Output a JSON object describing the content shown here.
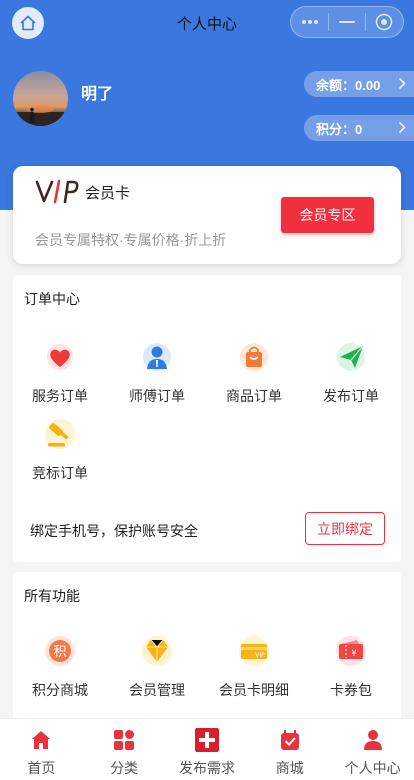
{
  "nav": {
    "title": "个人中心"
  },
  "user": {
    "name": "明了"
  },
  "account": {
    "balance_label": "余额：0.00",
    "points_label": "积分：0"
  },
  "vip": {
    "logo_text": "VIP",
    "title": "会员卡",
    "subtitle": "会员专属特权·专属价格·折上折",
    "button": "会员专区"
  },
  "orders": {
    "title": "订单中心",
    "items": [
      {
        "label": "服务订单",
        "icon": "heart-icon"
      },
      {
        "label": "师傅订单",
        "icon": "worker-icon"
      },
      {
        "label": "商品订单",
        "icon": "shopping-bag-icon"
      },
      {
        "label": "发布订单",
        "icon": "paper-plane-icon"
      },
      {
        "label": "竞标订单",
        "icon": "gavel-icon"
      }
    ],
    "bind_text": "绑定手机号，保护账号安全",
    "bind_button": "立即绑定"
  },
  "functions": {
    "title": "所有功能",
    "items": [
      {
        "label": "积分商城",
        "icon": "points-icon",
        "badge": "积"
      },
      {
        "label": "会员管理",
        "icon": "diamond-icon"
      },
      {
        "label": "会员卡明细",
        "icon": "vip-card-icon",
        "badge": "VIP"
      },
      {
        "label": "卡券包",
        "icon": "coupon-icon",
        "badge": "¥"
      }
    ]
  },
  "tabbar": [
    {
      "label": "首页",
      "icon": "home-icon"
    },
    {
      "label": "分类",
      "icon": "category-icon"
    },
    {
      "label": "发布需求",
      "icon": "add-icon"
    },
    {
      "label": "商城",
      "icon": "mall-icon"
    },
    {
      "label": "个人中心",
      "icon": "person-icon"
    }
  ],
  "colors": {
    "brand_blue": "#3a77de",
    "accent_red": "#f0303f"
  }
}
